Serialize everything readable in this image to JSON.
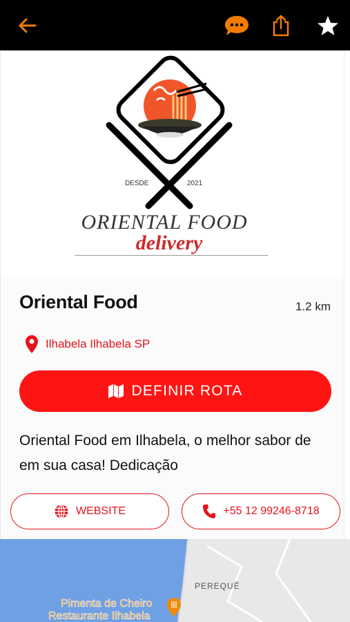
{
  "header": {
    "back_icon": "arrow-left-icon",
    "chat_icon": "chat-bubble-icon",
    "share_icon": "share-icon",
    "favorite_icon": "star-icon"
  },
  "logo": {
    "since_label": "DESDE",
    "year": "2021",
    "brand_line1": "ORIENTAL FOOD",
    "brand_line2": "delivery"
  },
  "place": {
    "name": "Oriental Food",
    "distance": "1.2 km",
    "location": "Ilhabela Ilhabela SP"
  },
  "actions": {
    "route_label": "DEFINIR ROTA",
    "website_label": "WEBSITE",
    "phone_label": "+55 12 99246-8718"
  },
  "description": "Oriental Food em Ilhabela, o melhor sabor de em sua casa! Dedicação",
  "map": {
    "area_label": "PEREQUÊ",
    "poi_line1": "Pimenta de Cheiro",
    "poi_line2": "Restaurante Ilhabela"
  },
  "colors": {
    "accent": "#ff1414",
    "icon_orange": "#f07d00",
    "map_water": "#6fa0e4"
  }
}
